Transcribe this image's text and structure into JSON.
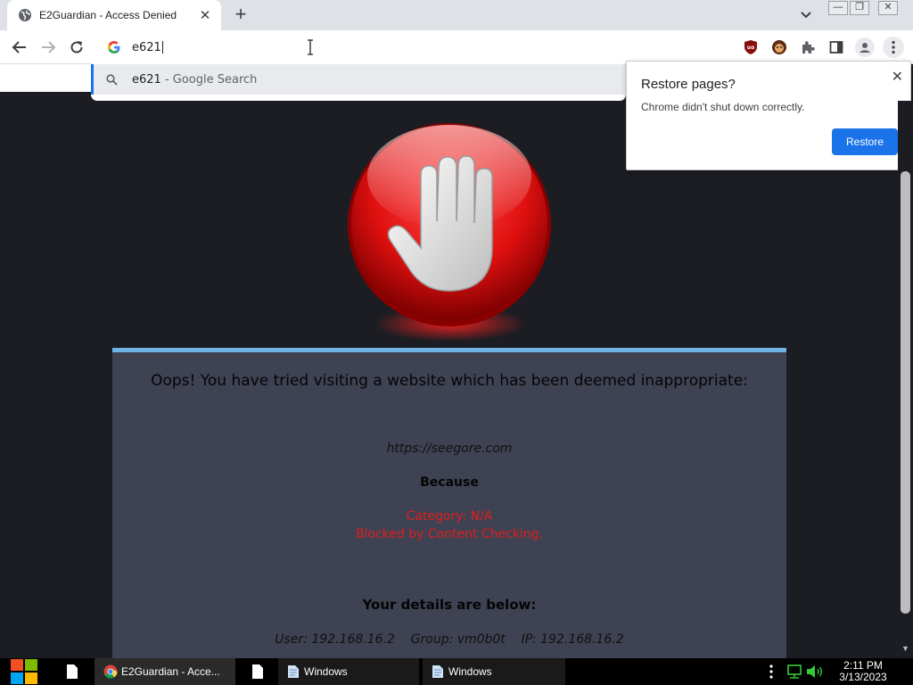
{
  "browser": {
    "tab": {
      "title": "E2Guardian - Access Denied",
      "close": "✕"
    },
    "new_tab": "+",
    "window_controls": {
      "minimize": "—",
      "restore": "❐",
      "close": "✕"
    },
    "omnibox": {
      "value": "e621"
    },
    "suggestion": {
      "query": "e621",
      "suffix": " - Google Search"
    }
  },
  "restore_bubble": {
    "title": "Restore pages?",
    "message": "Chrome didn't shut down correctly.",
    "button": "Restore",
    "close": "✕"
  },
  "page": {
    "headline": "Oops! You have tried visiting a website which has been deemed inappropriate:",
    "url": "https://seegore.com",
    "because": "Because",
    "reasons": [
      "Category: N/A",
      "Blocked by Content Checking."
    ],
    "details_heading": "Your details are below:",
    "details": "User: 192.168.16.2    Group: vm0b0t    IP: 192.168.16.2",
    "colors": {
      "panel": "#3e4252",
      "accent_bar": "#6eb3e4",
      "reason_text": "#e01e1e",
      "background": "#1c1d22"
    }
  },
  "taskbar": {
    "items": [
      {
        "label": "E2Guardian - Acce...",
        "active": true
      },
      {
        "label": "Windows",
        "active": false
      },
      {
        "label": "Windows",
        "active": false
      }
    ],
    "clock": {
      "time": "2:11 PM",
      "date": "3/13/2023"
    }
  }
}
